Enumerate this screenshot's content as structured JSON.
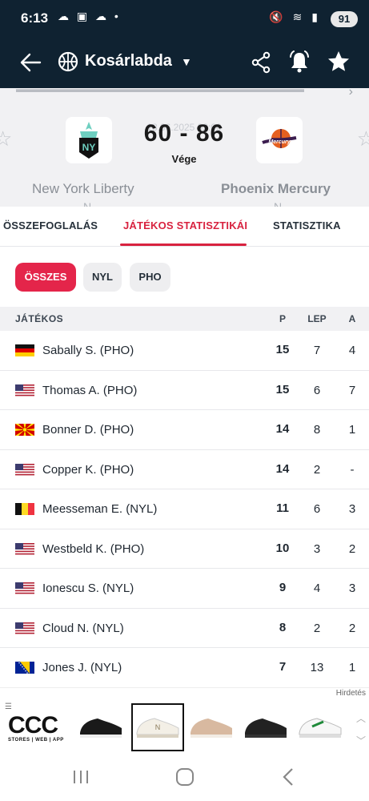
{
  "status_bar": {
    "time": "6:13",
    "battery": "91"
  },
  "app_bar": {
    "title": "Kosárlabda",
    "icons": [
      "back-arrow-icon",
      "basketball-icon",
      "caret-down-icon",
      "share-icon",
      "bell-icon",
      "star-icon"
    ]
  },
  "match": {
    "date": "18.06.2025 02:00",
    "score": "60 - 86",
    "status": "Vége",
    "home_team": "New York Liberty",
    "home_sub": "N",
    "away_team": "Phoenix Mercury",
    "away_sub": "N",
    "home_color": "#6ecfc0",
    "away_color": "#e56020"
  },
  "tabs": [
    {
      "label": "ÖSSZEFOGLALÁS",
      "active": false
    },
    {
      "label": "JÁTÉKOS STATISZTIKÁI",
      "active": true
    },
    {
      "label": "STATISZTIKA",
      "active": false
    }
  ],
  "filters": [
    {
      "label": "ÖSSZES",
      "active": true
    },
    {
      "label": "NYL",
      "active": false
    },
    {
      "label": "PHO",
      "active": false
    }
  ],
  "table": {
    "headers": {
      "player": "JÁTÉKOS",
      "p": "P",
      "lep": "LEP",
      "a": "A"
    },
    "rows": [
      {
        "flag": "germany",
        "name": "Sabally S. (PHO)",
        "p": "15",
        "lep": "7",
        "a": "4"
      },
      {
        "flag": "usa",
        "name": "Thomas A. (PHO)",
        "p": "15",
        "lep": "6",
        "a": "7"
      },
      {
        "flag": "north-macedonia",
        "name": "Bonner D. (PHO)",
        "p": "14",
        "lep": "8",
        "a": "1"
      },
      {
        "flag": "usa",
        "name": "Copper K. (PHO)",
        "p": "14",
        "lep": "2",
        "a": "-"
      },
      {
        "flag": "belgium",
        "name": "Meesseman E. (NYL)",
        "p": "11",
        "lep": "6",
        "a": "3"
      },
      {
        "flag": "usa",
        "name": "Westbeld K. (PHO)",
        "p": "10",
        "lep": "3",
        "a": "2"
      },
      {
        "flag": "usa",
        "name": "Ionescu S. (NYL)",
        "p": "9",
        "lep": "4",
        "a": "3"
      },
      {
        "flag": "usa",
        "name": "Cloud N. (NYL)",
        "p": "8",
        "lep": "2",
        "a": "2"
      },
      {
        "flag": "bosnia",
        "name": "Jones J. (NYL)",
        "p": "7",
        "lep": "13",
        "a": "1"
      }
    ]
  },
  "ad": {
    "label": "Hirdetés",
    "brand": "CCC",
    "brand_sub": "STORES | WEB | APP"
  },
  "colors": {
    "header_bg": "#0f2231",
    "accent": "#d8223f",
    "chip_active": "#e4254a"
  }
}
